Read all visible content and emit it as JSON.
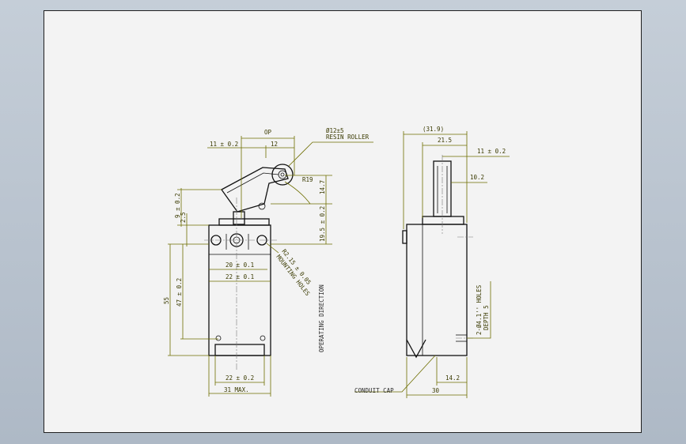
{
  "drawing": {
    "front_view": {
      "op_label": "OP",
      "dim_11_02": "11 ± 0.2",
      "dim_12": "12",
      "roller_dia": "Ø12±5",
      "roller_name": "RESIN ROLLER",
      "radius": "R19",
      "dim_14_7": "14.7",
      "dim_9_02": "9 ± 0.2",
      "dim_2_5": "2.5",
      "dim_19_5_02": "19.5 ± 0.2",
      "dim_55": "55",
      "dim_47_02": "47 ± 0.2",
      "dim_20_01": "20 ± 0.1",
      "dim_22_01": "22 ± 0.1",
      "dim_22_02": "22 ± 0.2",
      "dim_31max": "31 MAX.",
      "mount_line1": "R2.15 ± 0.05",
      "mount_line2": "MOUNTING HOLES",
      "operating_direction": "OPERATING DIRECTION"
    },
    "side_view": {
      "dim_31_9": "(31.9)",
      "dim_21_5": "21.5",
      "dim_11_02": "11 ± 0.2",
      "dim_10_2": "10.2",
      "holes_line1": "2-Ø4.1'' HOLES",
      "holes_line2": "DEPTH 5",
      "dim_14_2": "14.2",
      "dim_30": "30",
      "conduit_cap": "CONDUIT CAP"
    }
  }
}
